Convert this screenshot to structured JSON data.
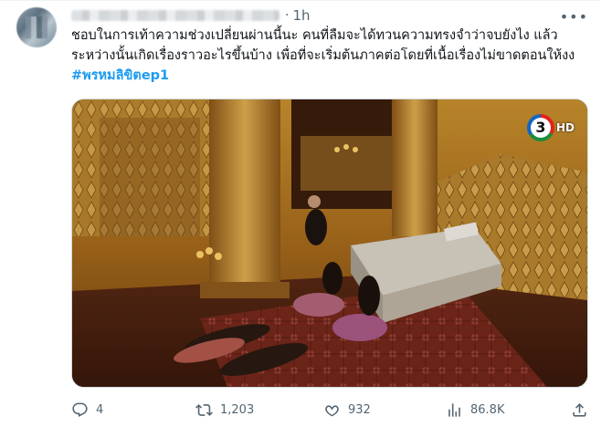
{
  "tweet": {
    "time": "1h",
    "text": "ชอบในการเท้าความช่วงเปลี่ยนผ่านนี้นะ คนที่ลืมจะได้ทวนความทรงจำว่าจบยังไง แล้วระหว่างนั้นเกิดเรื่องราวอะไรขึ้นบ้าง เพื่อที่จะเริ่มต้นภาคต่อโดยที่เนื้อเรื่องไม่ขาดตอนให้งง ",
    "hashtag": "#พรหมลิขิตep1",
    "more_icon": "more-horizontal-icon"
  },
  "media": {
    "channel_number": "3",
    "channel_hd": "HD",
    "description_icon": "video-frame"
  },
  "actions": {
    "reply_count": "4",
    "retweet_count": "1,203",
    "like_count": "932",
    "view_count": "86.8K"
  },
  "colors": {
    "accent": "#1d9bf0",
    "muted": "#536471",
    "text": "#0f1419"
  }
}
